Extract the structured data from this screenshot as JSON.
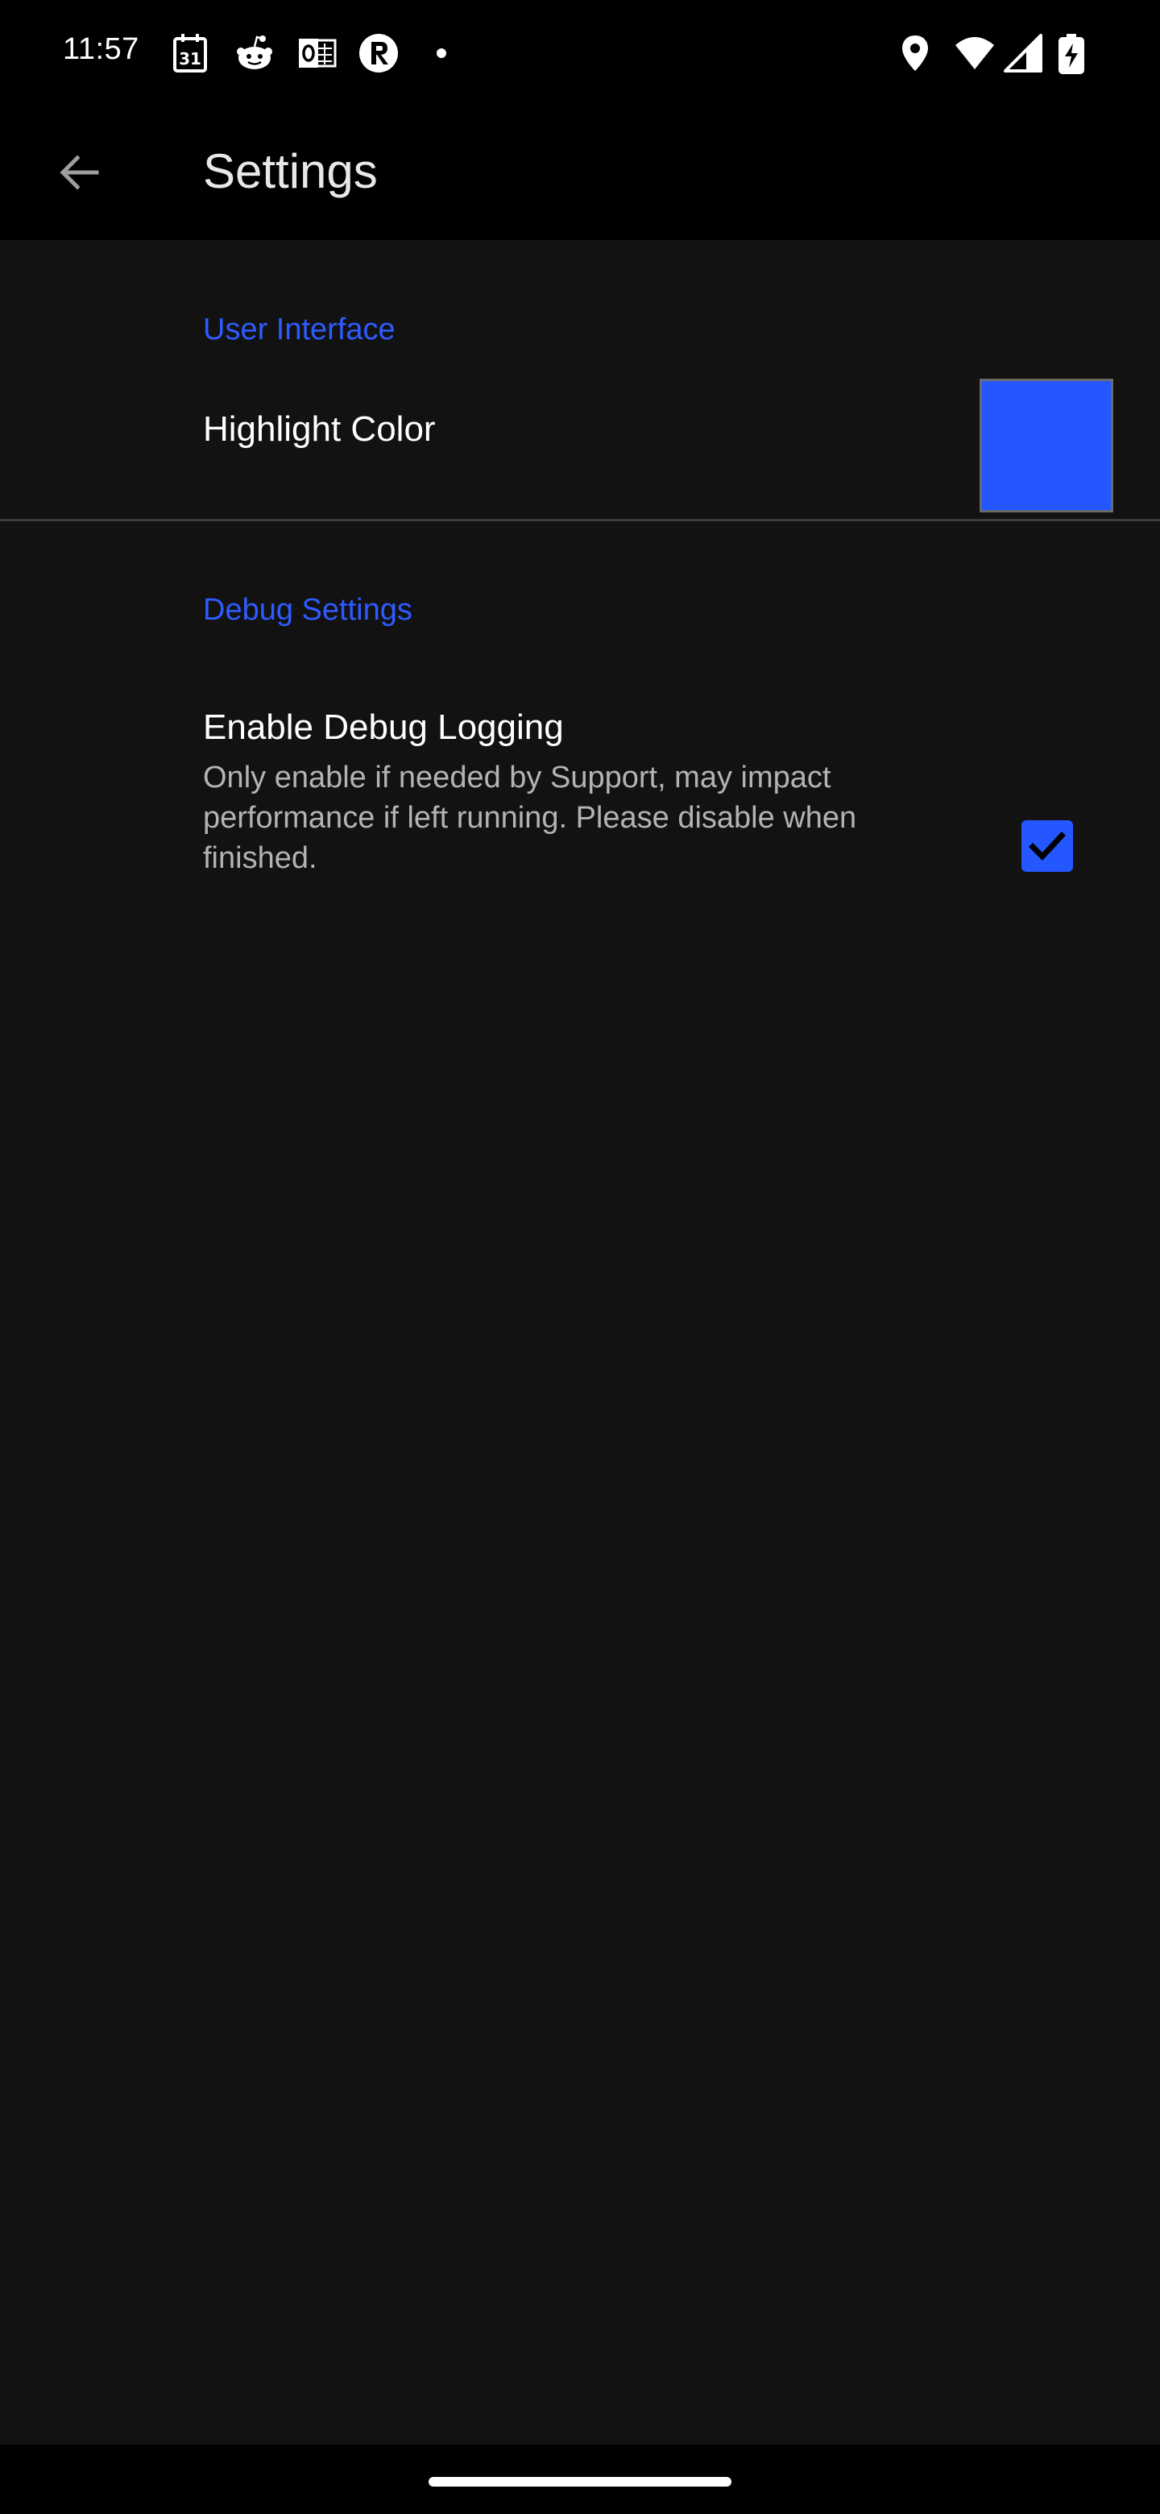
{
  "status_bar": {
    "time": "11:57",
    "calendar_day": "31",
    "left_icons": [
      "calendar-icon",
      "reddit-icon",
      "outlook-icon",
      "r-app-icon",
      "dot-icon"
    ],
    "right_icons": [
      "location-icon",
      "wifi-icon",
      "signal-icon",
      "battery-charging-icon"
    ]
  },
  "app_bar": {
    "title": "Settings",
    "back_icon": "arrow-left-icon"
  },
  "sections": {
    "user_interface": {
      "header": "User Interface",
      "highlight_color": {
        "title": "Highlight Color",
        "color": "#2457ff"
      }
    },
    "debug_settings": {
      "header": "Debug Settings",
      "enable_debug_logging": {
        "title": "Enable Debug Logging",
        "summary": "Only enable if needed by Support, may impact performance if left running. Please disable when finished.",
        "checked": true
      }
    }
  },
  "colors": {
    "accent": "#2e5bff",
    "background": "#121212",
    "bar_background": "#000000"
  }
}
